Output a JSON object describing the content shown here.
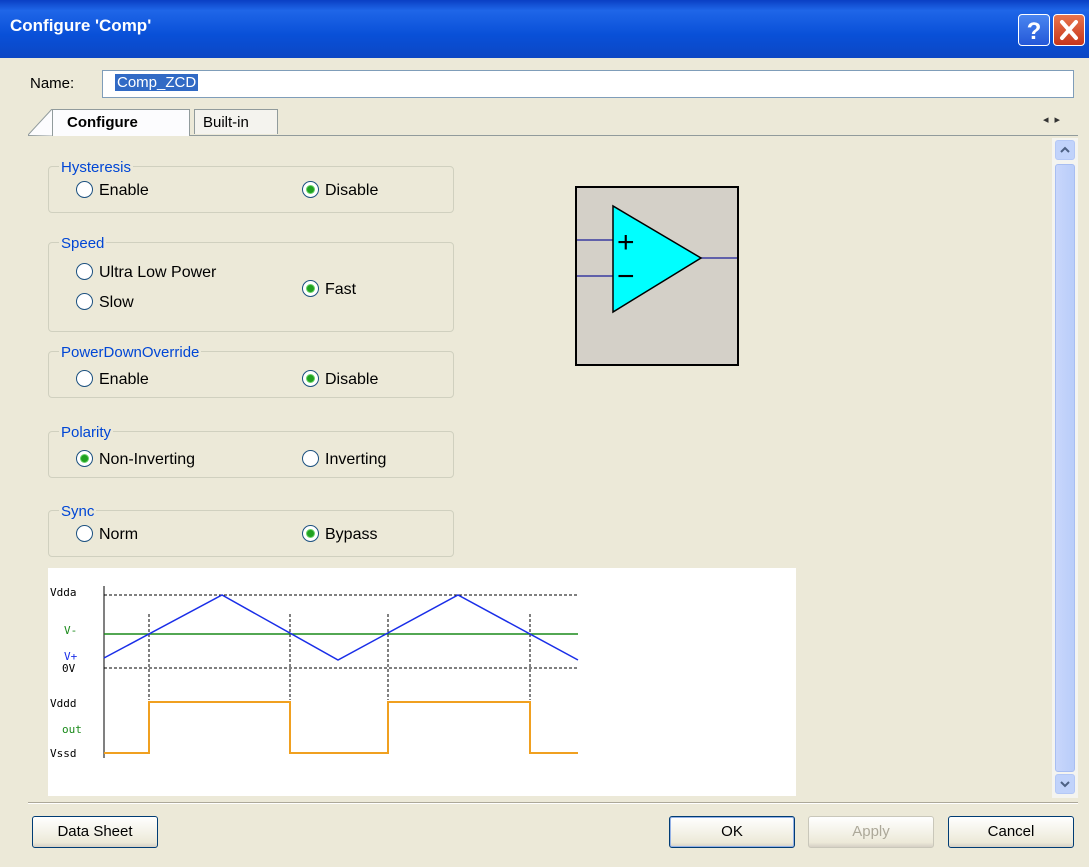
{
  "window": {
    "title": "Configure 'Comp'"
  },
  "name_field": {
    "label": "Name:",
    "value": "Comp_ZCD"
  },
  "tabs": [
    {
      "label": "Configure",
      "active": true
    },
    {
      "label": "Built-in",
      "active": false
    }
  ],
  "groups": {
    "hysteresis": {
      "title": "Hysteresis",
      "options": [
        "Enable",
        "Disable"
      ],
      "selected": "Disable"
    },
    "speed": {
      "title": "Speed",
      "options": [
        "Ultra Low Power",
        "Slow",
        "Fast"
      ],
      "selected": "Fast"
    },
    "power_down_override": {
      "title": "PowerDownOverride",
      "options": [
        "Enable",
        "Disable"
      ],
      "selected": "Disable"
    },
    "polarity": {
      "title": "Polarity",
      "options": [
        "Non-Inverting",
        "Inverting"
      ],
      "selected": "Non-Inverting"
    },
    "sync": {
      "title": "Sync",
      "options": [
        "Norm",
        "Bypass"
      ],
      "selected": "Bypass"
    }
  },
  "symbol": {
    "plus": "+",
    "minus": "−"
  },
  "waveform": {
    "labels": {
      "vdda": "Vdda",
      "vminus": "V-",
      "vplus": "V+",
      "zero": "0V",
      "vddd": "Vddd",
      "out": "out",
      "vssd": "Vssd"
    },
    "colors": {
      "triangle": "#1a2ee8",
      "vminus": "#1a8a1a",
      "out": "#f0a020"
    }
  },
  "buttons": {
    "datasheet": "Data Sheet",
    "ok": "OK",
    "apply": "Apply",
    "cancel": "Cancel"
  },
  "colors": {
    "titlebar": "#0950d8",
    "group_title": "#0046d5",
    "selected_dot": "#21a121"
  }
}
